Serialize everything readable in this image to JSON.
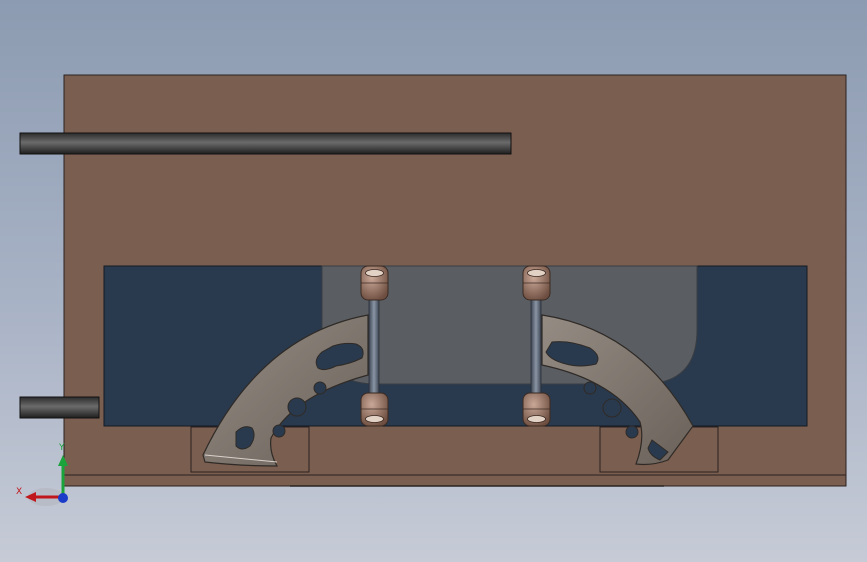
{
  "view": {
    "background_top": "#8c9bb1",
    "background_bottom": "#c6cbd6"
  },
  "colors": {
    "body": "#7a5e50",
    "body_edge": "#2b2220",
    "cavity": "#2a3a4e",
    "window": "#5a5e63",
    "arm": "#7e766e",
    "pin": "#5f6a7a",
    "bushing": "#8a6a5a"
  },
  "triad": {
    "x_label": "X",
    "y_label": "Y",
    "x_color": "#c0171c",
    "y_color": "#1aa33a",
    "z_color": "#1a3cc8"
  }
}
